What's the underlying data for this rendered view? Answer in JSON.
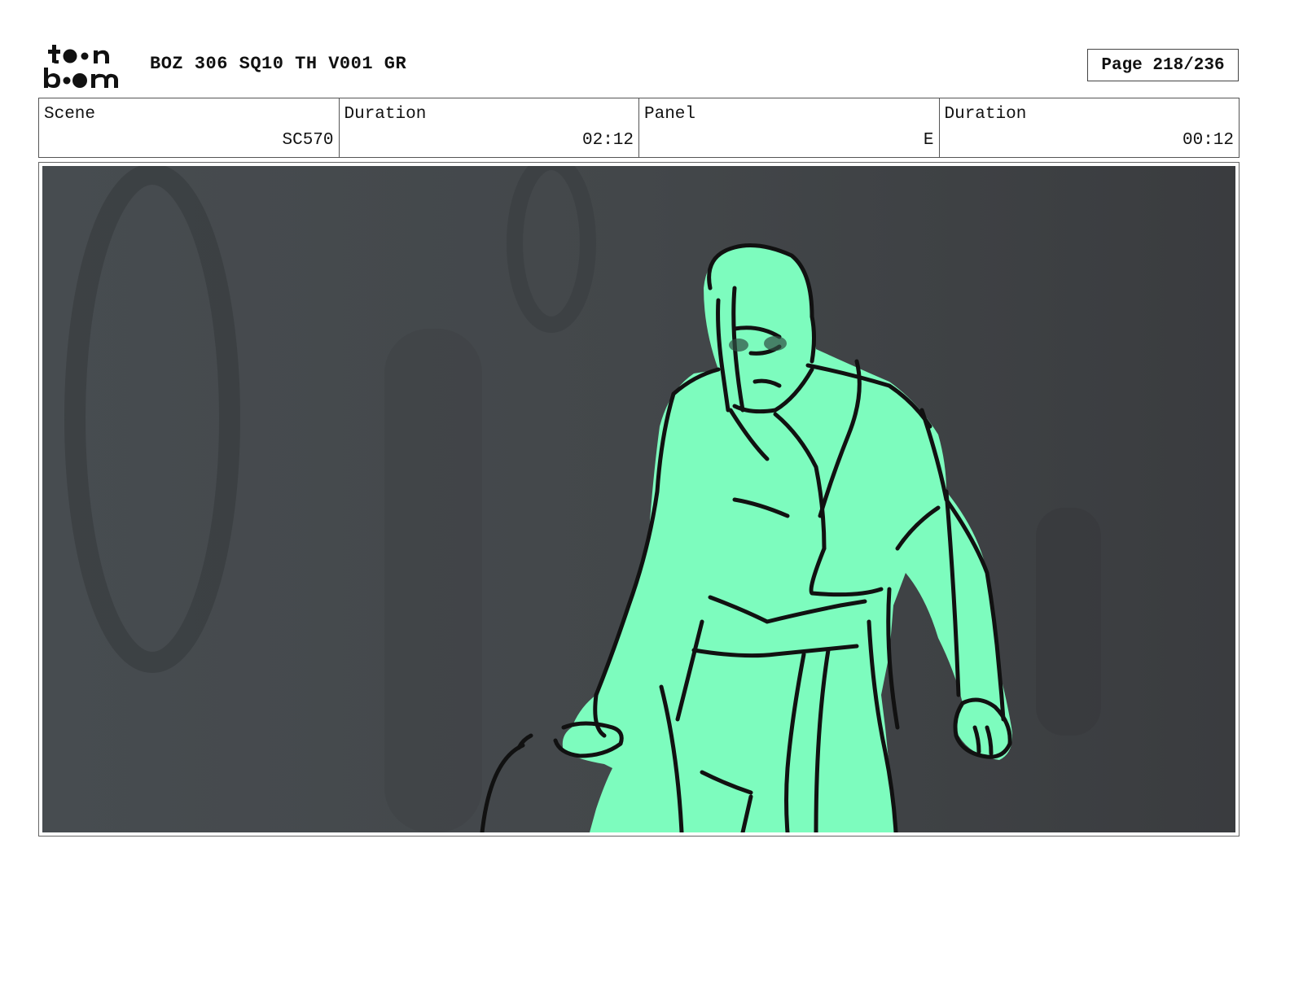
{
  "header": {
    "logo_text": "toon boom",
    "project_title": "BOZ 306 SQ10 TH V001 GR",
    "page_label": "Page 218/236"
  },
  "info": [
    {
      "label": "Scene",
      "value": "SC570"
    },
    {
      "label": "Duration",
      "value": "02:12"
    },
    {
      "label": "Panel",
      "value": "E"
    },
    {
      "label": "Duration",
      "value": "00:12"
    }
  ],
  "panel": {
    "background_color": "#45494c",
    "figure_color": "#7dfcbe",
    "line_color": "#111111"
  }
}
